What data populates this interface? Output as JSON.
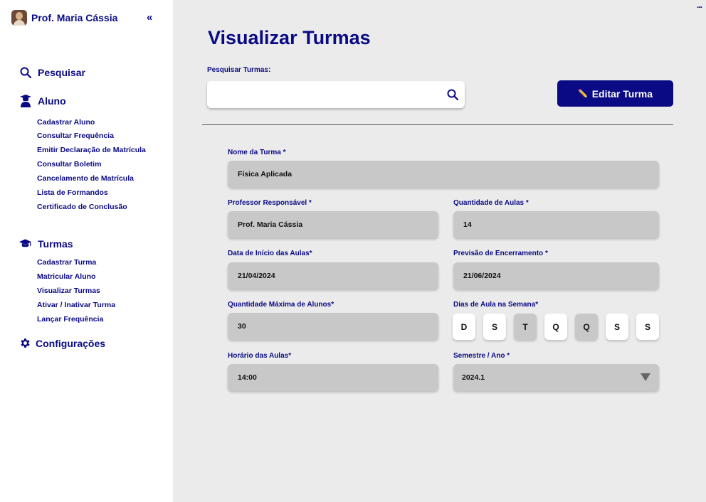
{
  "sidebar": {
    "profile_name": "Prof. Maria Cássia",
    "collapse_glyph": "«",
    "search_label": "Pesquisar",
    "aluno": {
      "label": "Aluno",
      "items": [
        "Cadastrar Aluno",
        "Consultar Frequência",
        "Emitir Declaração de Matrícula",
        "Consultar Boletim",
        "Cancelamento de Matrícula",
        "Lista de Formandos",
        "Certificado de Conclusão"
      ]
    },
    "turmas": {
      "label": "Turmas",
      "items": [
        "Cadastrar Turma",
        "Matricular Aluno",
        "Visualizar Turmas",
        "Ativar / Inativar Turma",
        "Lançar Frequência"
      ]
    },
    "settings_label": "Configurações"
  },
  "header": {
    "menu_glyph": "...",
    "title": "Visualizar Turmas",
    "search_label": "Pesquisar Turmas:",
    "search_value": "",
    "edit_button": "Editar Turma",
    "edit_icon": "✏️"
  },
  "form": {
    "nome_label": "Nome da Turma *",
    "nome_value": "Física Aplicada",
    "professor_label": "Professor Responsável *",
    "professor_value": "Prof. Maria Cássia",
    "aulas_label": "Quantidade de Aulas *",
    "aulas_value": "14",
    "inicio_label": "Data de Início das Aulas*",
    "inicio_value": "21/04/2024",
    "encerramento_label": "Previsão de Encerramento *",
    "encerramento_value": "21/06/2024",
    "max_alunos_label": "Quantidade Máxima de Alunos*",
    "max_alunos_value": "30",
    "dias_label": "Dias de Aula na Semana*",
    "dias": [
      {
        "letter": "D",
        "selected": false
      },
      {
        "letter": "S",
        "selected": false
      },
      {
        "letter": "T",
        "selected": true
      },
      {
        "letter": "Q",
        "selected": false
      },
      {
        "letter": "Q",
        "selected": true
      },
      {
        "letter": "S",
        "selected": false
      },
      {
        "letter": "S",
        "selected": false
      }
    ],
    "horario_label": "Horário das Aulas*",
    "horario_value": "14:00",
    "semestre_label": "Semestre / Ano *",
    "semestre_value": "2024.1"
  },
  "colors": {
    "primary": "#0a0a85",
    "background": "#ebebeb",
    "field": "#c8c8c8"
  }
}
